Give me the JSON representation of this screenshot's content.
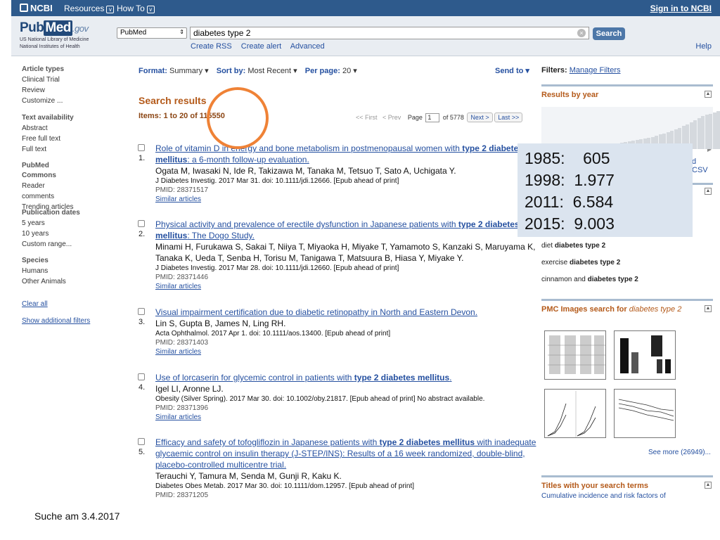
{
  "ncbi_bar": {
    "logo": "NCBI",
    "resources": "Resources",
    "howto": "How To",
    "signin": "Sign in to NCBI"
  },
  "header": {
    "logo_pub": "Pub",
    "logo_med": "Med",
    "logo_gov": ".gov",
    "logo_sub1": "US National Library of Medicine",
    "logo_sub2": "National Institutes of Health",
    "db_select": "PubMed",
    "search_value": "diabetes type 2",
    "search_button": "Search",
    "links": [
      "Create RSS",
      "Create alert",
      "Advanced"
    ],
    "help": "Help"
  },
  "sidebar": {
    "groups": [
      {
        "heading": "Article types",
        "items": [
          "Clinical Trial",
          "Review",
          "Customize ..."
        ]
      },
      {
        "heading": "Text availability",
        "items": [
          "Abstract",
          "Free full text",
          "Full text"
        ]
      },
      {
        "heading": "PubMed Commons",
        "items": [
          "Reader comments",
          "Trending articles"
        ]
      },
      {
        "heading": "Publication dates",
        "items": [
          "5 years",
          "10 years",
          "Custom range..."
        ]
      },
      {
        "heading": "Species",
        "items": [
          "Humans",
          "Other Animals"
        ]
      }
    ],
    "clear_all": "Clear all",
    "show_additional": "Show additional filters"
  },
  "toolbar": {
    "format_label": "Format:",
    "format_value": "Summary",
    "sort_label": "Sort by:",
    "sort_value": "Most Recent",
    "perpage_label": "Per page:",
    "perpage_value": "20",
    "send_to": "Send to"
  },
  "results_header": {
    "title": "Search results",
    "items": "Items: 1 to 20 of 115550"
  },
  "pager": {
    "first": "<< First",
    "prev": "< Prev",
    "page_label": "Page",
    "page_value": "1",
    "of_label": "of 5778",
    "next": "Next >",
    "last": "Last >>"
  },
  "results": [
    {
      "num": "1.",
      "title_parts": [
        "Role of vitamin D in energy and bone metabolism in postmenopausal women with ",
        "type 2 diabetes mellitus",
        ": a 6-month follow-up evaluation."
      ],
      "authors": "Ogata M, Iwasaki N, Ide R, Takizawa M, Tanaka M, Tetsuo T, Sato A, Uchigata Y.",
      "citation": "J Diabetes Investig. 2017 Mar 31. doi: 10.1111/jdi.12666. [Epub ahead of print]",
      "pmid": "PMID: 28371517",
      "similar": "Similar articles"
    },
    {
      "num": "2.",
      "title_parts": [
        "Physical activity and prevalence of erectile dysfunction in Japanese patients with ",
        "type 2 diabetes mellitus",
        ": The Dogo Study."
      ],
      "authors": "Minami H, Furukawa S, Sakai T, Niiya T, Miyaoka H, Miyake T, Yamamoto S, Kanzaki S, Maruyama K, Tanaka K, Ueda T, Senba H, Torisu M, Tanigawa T, Matsuura B, Hiasa Y, Miyake Y.",
      "citation": "J Diabetes Investig. 2017 Mar 28. doi: 10.1111/jdi.12660. [Epub ahead of print]",
      "pmid": "PMID: 28371446",
      "similar": "Similar articles"
    },
    {
      "num": "3.",
      "title_parts": [
        "Visual impairment certification due to diabetic retinopathy in North and Eastern Devon.",
        "",
        ""
      ],
      "authors": "Lin S, Gupta B, James N, Ling RH.",
      "citation": "Acta Ophthalmol. 2017 Apr 1. doi: 10.1111/aos.13400. [Epub ahead of print]",
      "pmid": "PMID: 28371403",
      "similar": "Similar articles"
    },
    {
      "num": "4.",
      "title_parts": [
        "Use of lorcaserin for glycemic control in patients with ",
        "type 2 diabetes mellitus",
        "."
      ],
      "authors": "Igel LI, Aronne LJ.",
      "citation": "Obesity (Silver Spring). 2017 Mar 30. doi: 10.1002/oby.21817. [Epub ahead of print] No abstract available.",
      "pmid": "PMID: 28371396",
      "similar": "Similar articles"
    },
    {
      "num": "5.",
      "title_parts": [
        "Efficacy and safety of tofogliflozin in Japanese patients with ",
        "type 2 diabetes mellitus",
        " with inadequate glycaemic control on insulin therapy (J-STEP/INS): Results of a 16 week randomized, double-blind, placebo-controlled multicentre trial."
      ],
      "authors": "Terauchi Y, Tamura M, Senda M, Gunji R, Kaku K.",
      "citation": "Diabetes Obes Metab. 2017 Mar 30. doi: 10.1111/dom.12957. [Epub ahead of print]",
      "pmid": "PMID: 28371205",
      "similar": ""
    }
  ],
  "right": {
    "filters_label": "Filters:",
    "manage_filters": "Manage Filters",
    "results_by_year": "Results by year",
    "year_bars": [
      2,
      3,
      3,
      4,
      4,
      5,
      5,
      6,
      6,
      7,
      8,
      8,
      9,
      10,
      11,
      12,
      13,
      14,
      15,
      16,
      17,
      18,
      20,
      22,
      24,
      26,
      28,
      30,
      32,
      35,
      38,
      41,
      44,
      47,
      50,
      52,
      54,
      56,
      58,
      60
    ],
    "download_csv": "d CSV",
    "related": [
      {
        "pre": "diet ",
        "bold": "diabetes type 2"
      },
      {
        "pre": "exercise ",
        "bold": "diabetes type 2"
      },
      {
        "pre": "cinnamon and ",
        "bold": "diabetes type 2"
      }
    ],
    "pmc_title": "PMC Images search for",
    "pmc_query": "diabetes type 2",
    "see_more": "See more (26949)...",
    "titles_heading": "Titles with your search terms",
    "titles_sub": "Cumulative incidence and risk factors of"
  },
  "overlay": {
    "rows": [
      "1985:    605",
      "1998:  1.977",
      "2011:  6.584",
      "2015:  9.003"
    ]
  },
  "caption": "Suche am 3.4.2017",
  "colors": {
    "ncbi_bar": "#2e5a8c",
    "link": "#2550a0",
    "heading": "#b45a1a",
    "ring": "#ef8236",
    "overlay_bg": "#dbe4ef"
  }
}
